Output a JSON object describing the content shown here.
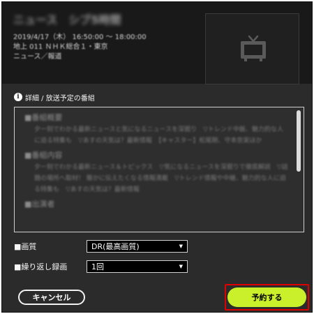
{
  "program": {
    "title": "ニュース　シブ5時間",
    "time": "2019/4/17（木） 16:50:00 ～ 18:00:00",
    "channel": "地上 011 ＮＨＫ総合１・東京",
    "genre": "ニュース／報道"
  },
  "details": {
    "header": "詳細 / 放送予定の番組",
    "sections": [
      {
        "label": "■番組概要",
        "body": "夕一刻でわかる最新ニュースと気になるニュースを深掘り　▽トレンド中飯、魅力的な人に迫る特集も　▽あすの天気は？最新情報　【キャスター】松尾剛、守本奈実ほか"
      },
      {
        "label": "■番組内容",
        "body": "夕一刻でわかる最新ニュース＆トピックス　▽気になるニュースを深掘りで徹底解説　▽話題の場所へ取材！ 賑かに伝えたくなる情報満載　▽トレンド情報や中継、魅力的な人に迫る特集も　▽あすの天気は？最新情報"
      },
      {
        "label": "■出演者",
        "body": ""
      }
    ]
  },
  "settings": {
    "quality_label": "■画質",
    "quality_value": "DR(最高画質)",
    "repeat_label": "■繰り返し録画",
    "repeat_value": "1回"
  },
  "buttons": {
    "cancel": "キャンセル",
    "reserve": "予約する"
  },
  "colors": {
    "background": "#2b2b2b",
    "header": "#191919",
    "accent": "#c9f02a",
    "highlight": "#e00000"
  }
}
